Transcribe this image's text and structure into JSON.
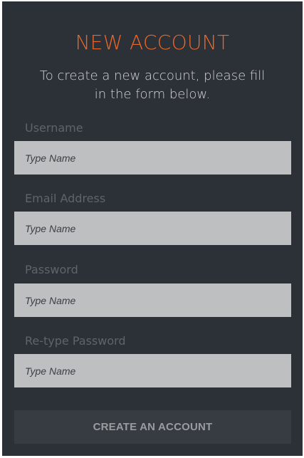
{
  "header": {
    "title": "NEW ACCOUNT",
    "subtitle": "To create a new account, please fill in the form below."
  },
  "form": {
    "fields": [
      {
        "label": "Username",
        "placeholder": "Type Name",
        "value": ""
      },
      {
        "label": "Email Address",
        "placeholder": "Type Name",
        "value": ""
      },
      {
        "label": "Password",
        "placeholder": "Type Name",
        "value": ""
      },
      {
        "label": "Re-type Password",
        "placeholder": "Type Name",
        "value": ""
      }
    ],
    "submit_label": "CREATE AN ACCOUNT"
  },
  "colors": {
    "panel_background": "#2c3037",
    "accent": "#e8672a",
    "input_background": "#bebfc0",
    "button_background": "#373b42"
  }
}
